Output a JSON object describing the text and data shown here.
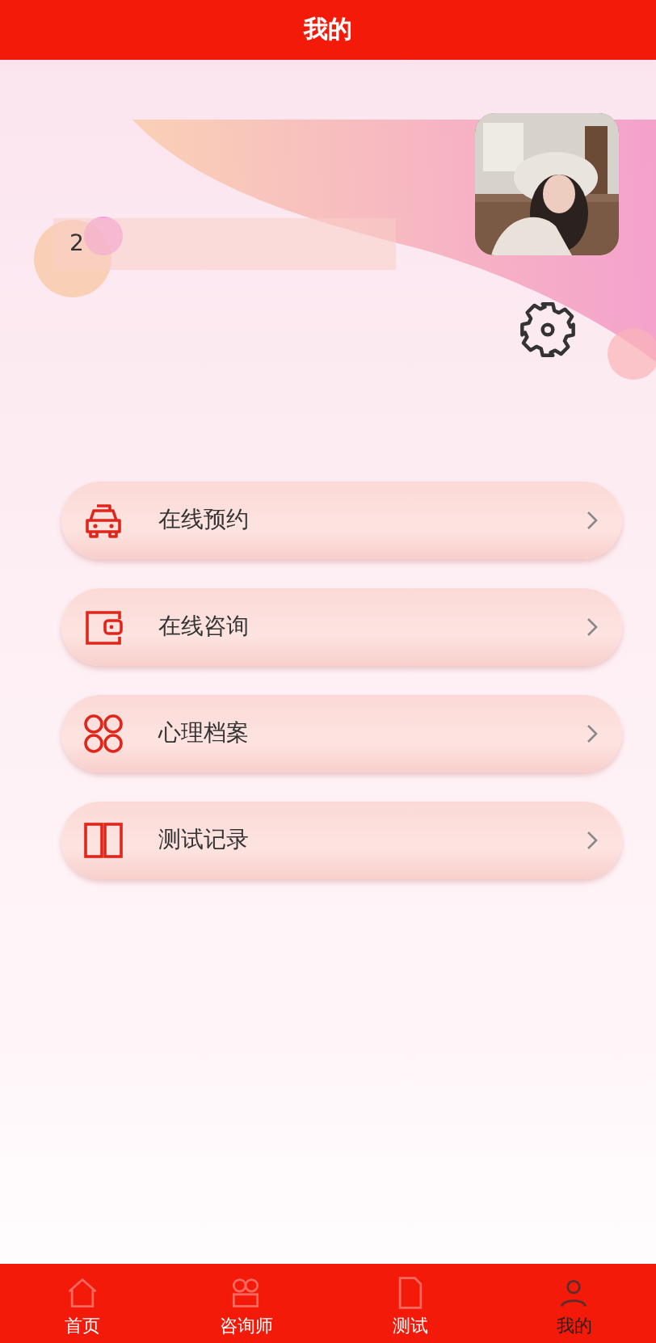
{
  "header": {
    "title": "我的"
  },
  "profile": {
    "field_value": "2"
  },
  "menu": [
    {
      "label": "在线预约",
      "kind": "car"
    },
    {
      "label": "在线咨询",
      "kind": "wallet"
    },
    {
      "label": "心理档案",
      "kind": "grid"
    },
    {
      "label": "测试记录",
      "kind": "book"
    }
  ],
  "tabbar": [
    {
      "label": "首页",
      "kind": "home",
      "selected": false
    },
    {
      "label": "咨询师",
      "kind": "people",
      "selected": false
    },
    {
      "label": "测试",
      "kind": "doc",
      "selected": false
    },
    {
      "label": "我的",
      "kind": "user",
      "selected": true
    }
  ]
}
